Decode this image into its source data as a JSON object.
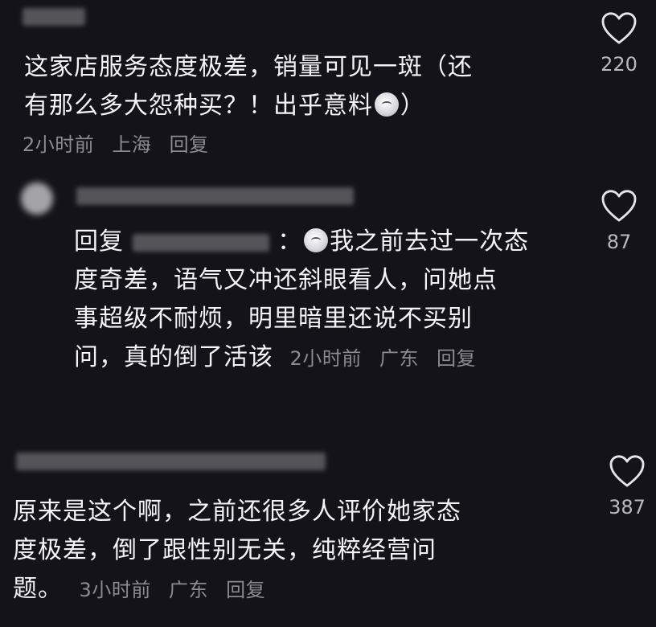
{
  "comments": [
    {
      "text_line1": "这家店服务态度极差，销量可见一斑（还",
      "text_line2_a": "有那么多大怨种买？！出乎意料",
      "text_line2_b": "）",
      "time": "2小时前",
      "location": "上海",
      "reply_label": "回复",
      "likes": "220",
      "emoji_icon": "shocked-face-emoji"
    },
    {
      "is_reply": true,
      "reply_prefix": "回复",
      "text_line1": "我之前去过一次态",
      "text_line2": "度奇差，语气又冲还斜眼看人，问她点",
      "text_line3": "事超级不耐烦，明里暗里还说不买别",
      "text_line4": "问，真的倒了活该",
      "time": "2小时前",
      "location": "广东",
      "reply_label": "回复",
      "likes": "87",
      "emoji_icon": "sad-face-emoji"
    },
    {
      "text_line1": "原来是这个啊，之前还很多人评价她家态",
      "text_line2": "度极差，倒了跟性别无关，纯粹经营问",
      "text_line3": "题。",
      "time": "3小时前",
      "location": "广东",
      "reply_label": "回复",
      "likes": "387"
    }
  ],
  "colors": {
    "background": "#141319",
    "text": "#f4f4f6",
    "meta": "#8b8b93",
    "heart_outline": "#e6e6ea"
  }
}
